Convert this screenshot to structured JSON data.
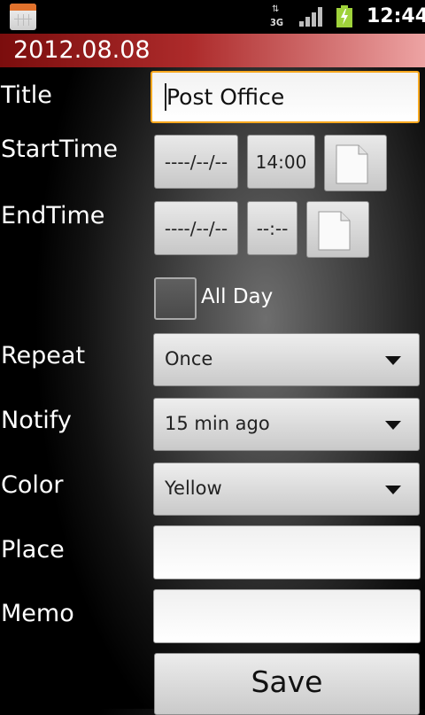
{
  "status_bar": {
    "network_type": "3G",
    "time": "12:44"
  },
  "header": {
    "date": "2012.08.08"
  },
  "form": {
    "title_label": "Title",
    "title_value": "Post Office",
    "start_label": "StartTime",
    "start_date": "----/--/--",
    "start_time": "14:00",
    "end_label": "EndTime",
    "end_date": "----/--/--",
    "end_time": "--:--",
    "all_day_label": "All Day",
    "all_day_checked": false,
    "repeat_label": "Repeat",
    "repeat_value": "Once",
    "notify_label": "Notify",
    "notify_value": "15 min ago",
    "color_label": "Color",
    "color_value": "Yellow",
    "place_label": "Place",
    "place_value": "",
    "memo_label": "Memo",
    "memo_value": "",
    "save_label": "Save"
  },
  "icons": {
    "app": "calendar-icon",
    "network": "3g-data-icon",
    "signal": "signal-strength-icon",
    "battery": "battery-charging-icon",
    "note": "note-icon",
    "dropdown": "dropdown-arrow-icon"
  },
  "colors": {
    "title_bar_start": "#7b0d0d",
    "title_bar_end": "#eda3a3",
    "focus_border": "#f7a81f",
    "battery": "#9fd23b"
  }
}
